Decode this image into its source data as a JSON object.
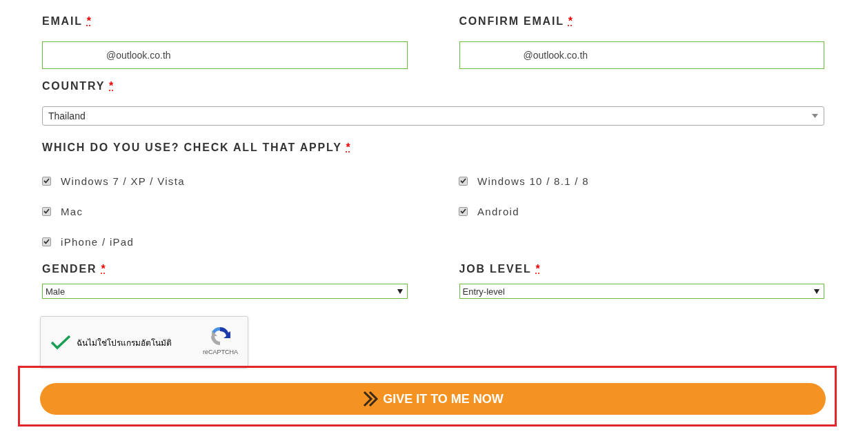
{
  "email": {
    "label": "EMAIL",
    "required": "*",
    "value": "@outlook.co.th"
  },
  "confirm_email": {
    "label": "CONFIRM EMAIL",
    "required": "*",
    "value": "@outlook.co.th"
  },
  "country": {
    "label": "COUNTRY",
    "required": "*",
    "value": "Thailand"
  },
  "devices": {
    "label": "WHICH DO YOU USE? CHECK ALL THAT APPLY",
    "required": "*",
    "options": [
      {
        "label": "Windows 7 / XP / Vista",
        "checked": true
      },
      {
        "label": "Windows 10 / 8.1 / 8",
        "checked": true
      },
      {
        "label": "Mac",
        "checked": true
      },
      {
        "label": "Android",
        "checked": true
      },
      {
        "label": "iPhone / iPad",
        "checked": true
      }
    ]
  },
  "gender": {
    "label": "GENDER",
    "required": "*",
    "value": "Male"
  },
  "job_level": {
    "label": "JOB LEVEL",
    "required": "*",
    "value": "Entry-level"
  },
  "captcha": {
    "checked": true,
    "text": "ฉันไม่ใช่โปรแกรมอัตโนมัติ",
    "brand": "reCAPTCHA"
  },
  "submit": {
    "label": "GIVE IT TO ME NOW",
    "highlighted": true
  }
}
